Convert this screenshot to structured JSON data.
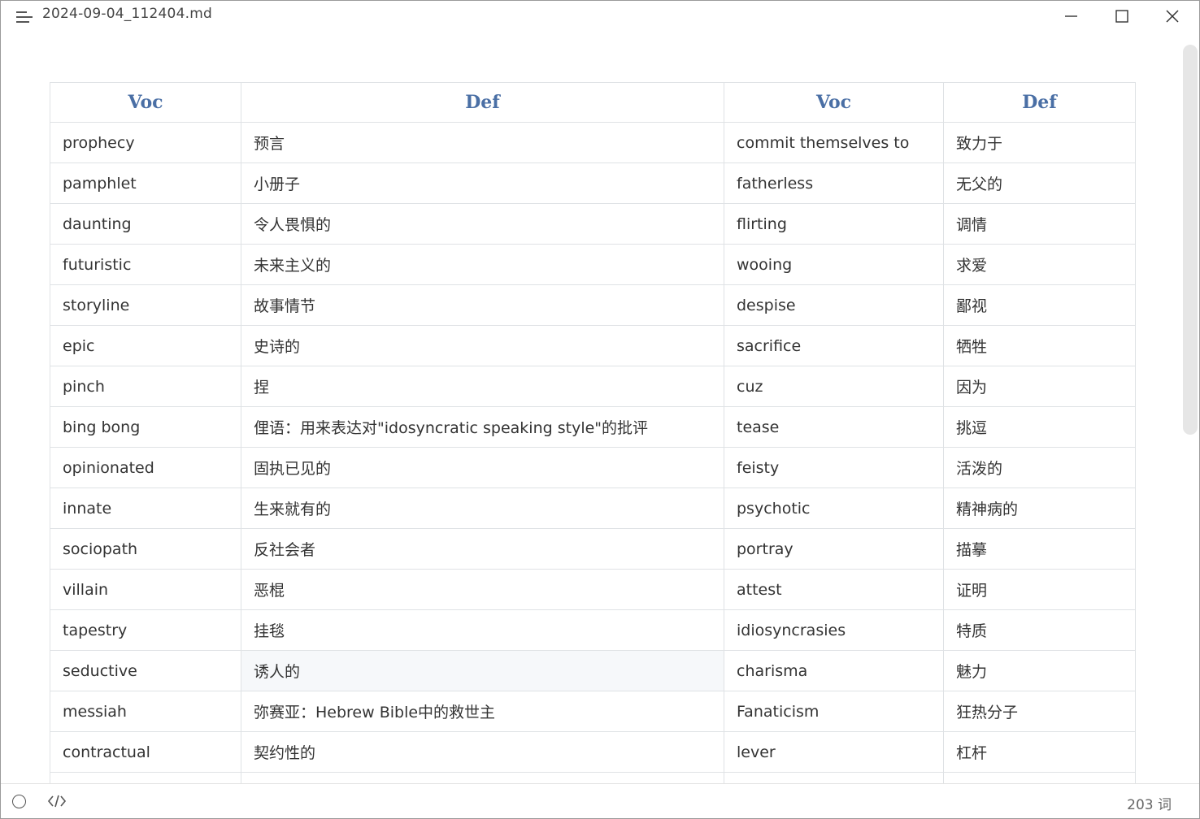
{
  "window": {
    "title": "2024-09-04_112404.md"
  },
  "table": {
    "headers": [
      "Voc",
      "Def",
      "Voc",
      "Def"
    ],
    "rows": [
      [
        "prophecy",
        "预言",
        "commit themselves to",
        "致力于"
      ],
      [
        "pamphlet",
        "小册子",
        "fatherless",
        "无父的"
      ],
      [
        "daunting",
        "令人畏惧的",
        "flirting",
        "调情"
      ],
      [
        "futuristic",
        "未来主义的",
        "wooing",
        "求爱"
      ],
      [
        "storyline",
        "故事情节",
        "despise",
        "鄙视"
      ],
      [
        "epic",
        "史诗的",
        "sacrifice",
        "牺牲"
      ],
      [
        "pinch",
        "捏",
        "cuz",
        "因为"
      ],
      [
        "bing bong",
        "俚语：用来表达对\"idosyncratic speaking style\"的批评",
        "tease",
        "挑逗"
      ],
      [
        "opinionated",
        "固执已见的",
        "feisty",
        "活泼的"
      ],
      [
        "innate",
        "生来就有的",
        "psychotic",
        "精神病的"
      ],
      [
        "sociopath",
        "反社会者",
        "portray",
        "描摹"
      ],
      [
        "villain",
        "恶棍",
        "attest",
        "证明"
      ],
      [
        "tapestry",
        "挂毯",
        "idiosyncrasies",
        "特质"
      ],
      [
        "seductive",
        "诱人的",
        "charisma",
        "魅力"
      ],
      [
        "messiah",
        "弥赛亚：Hebrew Bible中的救世主",
        "Fanaticism",
        "狂热分子"
      ],
      [
        "contractual",
        "契约性的",
        "lever",
        "杠杆"
      ],
      [
        "",
        "",
        "",
        ""
      ]
    ]
  },
  "statusbar": {
    "word_count": "203 词"
  }
}
